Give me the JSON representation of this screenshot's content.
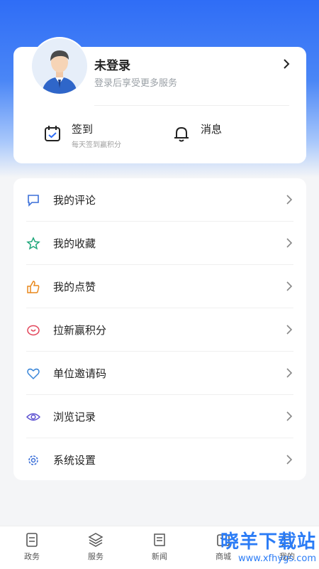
{
  "profile": {
    "title": "未登录",
    "subtitle": "登录后享受更多服务"
  },
  "quick": [
    {
      "icon": "calendar-check-icon",
      "title": "签到",
      "subtitle": "每天签到赢积分"
    },
    {
      "icon": "bell-icon",
      "title": "消息",
      "subtitle": ""
    }
  ],
  "menu": [
    {
      "icon": "comment-icon",
      "label": "我的评论",
      "color": "#3b6fd8"
    },
    {
      "icon": "star-icon",
      "label": "我的收藏",
      "color": "#1fa67a"
    },
    {
      "icon": "thumbs-up-icon",
      "label": "我的点赞",
      "color": "#e8891d"
    },
    {
      "icon": "gift-icon",
      "label": "拉新赢积分",
      "color": "#e2455a"
    },
    {
      "icon": "heart-icon",
      "label": "单位邀请码",
      "color": "#3a86d8"
    },
    {
      "icon": "eye-icon",
      "label": "浏览记录",
      "color": "#5b4fd0"
    },
    {
      "icon": "gear-icon",
      "label": "系统设置",
      "color": "#3b6fd8"
    }
  ],
  "tabs": [
    {
      "icon": "document-icon",
      "label": "政务"
    },
    {
      "icon": "layers-icon",
      "label": "服务"
    },
    {
      "icon": "newspaper-icon",
      "label": "新闻"
    },
    {
      "icon": "shop-icon",
      "label": "商城"
    },
    {
      "icon": "user-icon",
      "label": "我的"
    }
  ],
  "watermark": {
    "title": "晓羊下载站",
    "url": "www.xfhygs.com"
  }
}
